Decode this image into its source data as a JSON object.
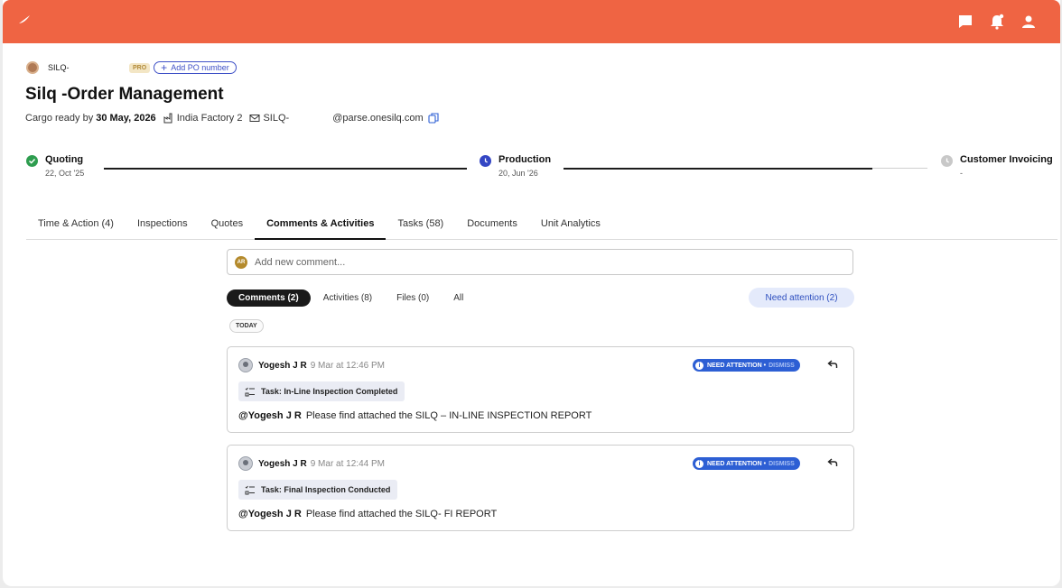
{
  "header": {
    "icons": [
      "feather-logo-icon",
      "chat-icon",
      "notification-bell-icon",
      "user-icon"
    ]
  },
  "order": {
    "code_prefix": "SILQ-",
    "pro_badge": "PRO",
    "add_po_label": "Add PO number",
    "title": "Silq -Order Management",
    "cargo_ready_label": "Cargo ready by",
    "cargo_ready_date": "30 May, 2026",
    "factory": "India Factory 2",
    "email_local": "SILQ-",
    "email_domain": "@parse.onesilq.com"
  },
  "progress": {
    "stages": [
      {
        "name": "Quoting",
        "date": "22, Oct '25",
        "status": "done",
        "color": "#2e9d4f"
      },
      {
        "name": "Production",
        "date": "20, Jun '26",
        "status": "current",
        "color": "#3446c4"
      },
      {
        "name": "Customer Invoicing",
        "date": "-",
        "status": "pending",
        "color": "#c8c8c8"
      }
    ]
  },
  "tabs": [
    {
      "label": "Time & Action (4)",
      "active": false
    },
    {
      "label": "Inspections",
      "active": false
    },
    {
      "label": "Quotes",
      "active": false
    },
    {
      "label": "Comments & Activities",
      "active": true
    },
    {
      "label": "Tasks (58)",
      "active": false
    },
    {
      "label": "Documents",
      "active": false
    },
    {
      "label": "Unit Analytics",
      "active": false
    }
  ],
  "comment_box": {
    "avatar_initials": "AR",
    "placeholder": "Add new comment..."
  },
  "filters": [
    {
      "label": "Comments (2)",
      "active": true
    },
    {
      "label": "Activities (8)",
      "active": false
    },
    {
      "label": "Files (0)",
      "active": false
    },
    {
      "label": "All",
      "active": false
    }
  ],
  "need_attention_filter": "Need attention (2)",
  "date_divider": "TODAY",
  "comments": [
    {
      "author": "Yogesh J R",
      "time": "9 Mar at 12:46 PM",
      "attention_label": "NEED ATTENTION •",
      "dismiss_label": "DISMISS",
      "task": "Task: In-Line Inspection Completed",
      "mention": "@Yogesh J R",
      "text": "Please find attached the SILQ – IN-LINE INSPECTION REPORT"
    },
    {
      "author": "Yogesh J R",
      "time": "9 Mar at 12:44 PM",
      "attention_label": "NEED ATTENTION •",
      "dismiss_label": "DISMISS",
      "task": "Task: Final Inspection Conducted",
      "mention": "@Yogesh J R",
      "text": "Please find attached the SILQ- FI REPORT"
    }
  ],
  "colors": {
    "brand": "#ef6443",
    "accent_blue": "#2d5fd4",
    "success": "#2e9d4f"
  }
}
